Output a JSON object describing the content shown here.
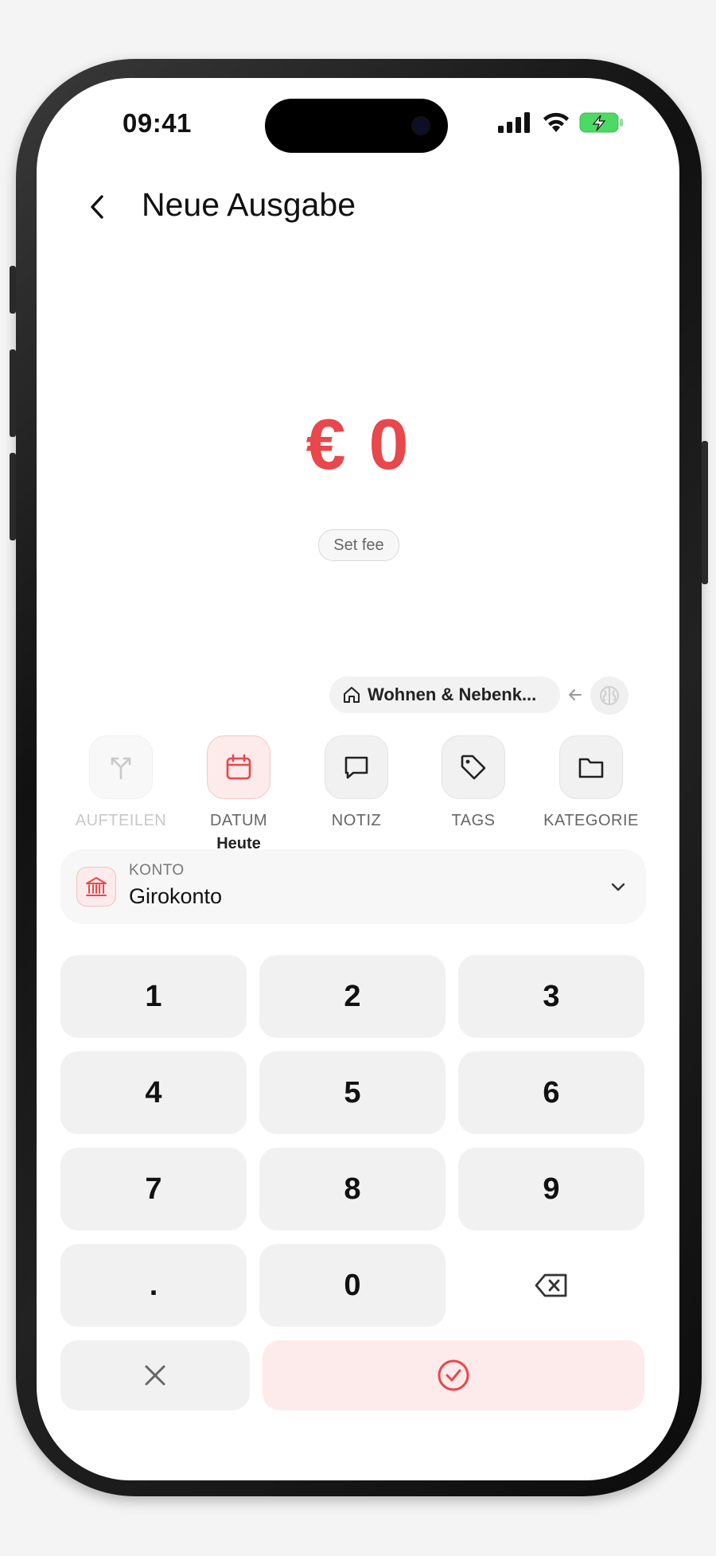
{
  "status_bar": {
    "time": "09:41"
  },
  "header": {
    "title": "Neue Ausgabe"
  },
  "amount": {
    "value": "€ 0",
    "fee_label": "Set fee"
  },
  "category_suggestion": {
    "label": "Wohnen & Nebenk..."
  },
  "actions": [
    {
      "label": "AUFTEILEN",
      "icon": "split-icon",
      "state": "disabled"
    },
    {
      "label": "DATUM",
      "icon": "calendar-icon",
      "state": "active",
      "sub": "Heute"
    },
    {
      "label": "NOTIZ",
      "icon": "note-icon",
      "state": "normal"
    },
    {
      "label": "TAGS",
      "icon": "tag-icon",
      "state": "normal"
    },
    {
      "label": "KATEGORIE",
      "icon": "folder-icon",
      "state": "normal"
    }
  ],
  "account": {
    "label": "KONTO",
    "value": "Girokonto"
  },
  "keypad": {
    "keys": [
      "1",
      "2",
      "3",
      "4",
      "5",
      "6",
      "7",
      "8",
      "9",
      ".",
      "0"
    ]
  },
  "colors": {
    "accent": "#e8474b",
    "accent_soft": "#fdeaea",
    "key_bg": "#f1f1f1"
  }
}
